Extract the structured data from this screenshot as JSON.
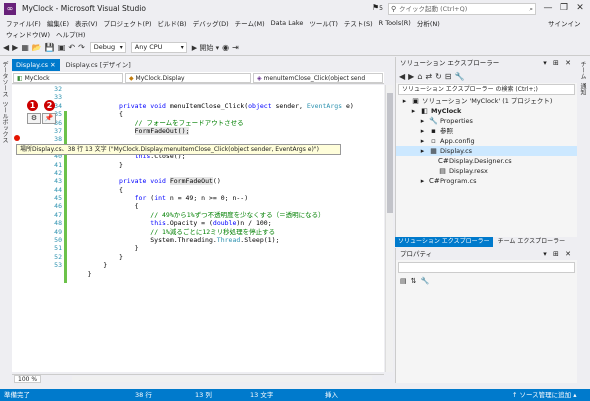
{
  "window": {
    "title": "MyClock - Microsoft Visual Studio",
    "minimize": "—",
    "restore": "❐",
    "close": "✕"
  },
  "notifications": {
    "count": "5"
  },
  "quick_launch": {
    "placeholder": "クイック起動 (Ctrl+Q)"
  },
  "menu": [
    "ファイル(F)",
    "編集(E)",
    "表示(V)",
    "プロジェクト(P)",
    "ビルド(B)",
    "デバッグ(D)",
    "チーム(M)",
    "Data Lake",
    "ツール(T)",
    "テスト(S)",
    "R Tools(R)",
    "分析(N)"
  ],
  "menu2": [
    "ウィンドウ(W)",
    "ヘルプ(H)"
  ],
  "signin": "サインイン",
  "toolbar": {
    "config": "Debug",
    "platform": "Any CPU",
    "start": "▶ 開始 ▾"
  },
  "left_tabs": [
    "データソース",
    "ツールボックス"
  ],
  "right_tabs": [
    "チーム",
    "通知"
  ],
  "doc_tabs": [
    {
      "label": "Display.cs",
      "close": "✕"
    },
    {
      "label": "Display.cs [デザイン]"
    }
  ],
  "nav": {
    "project": "MyClock",
    "class": "MyClock.Display",
    "member": "menuItemClose_Click(object send"
  },
  "line_numbers": [
    "32",
    "33",
    "34",
    "35",
    "36",
    "37",
    "38",
    "39",
    "40",
    "41",
    "42",
    "43",
    "44",
    "45",
    "46",
    "47",
    "48",
    "49",
    "50",
    "51",
    "52",
    "53"
  ],
  "code_lines": [
    {
      "parts": [
        {
          "t": "            ",
          "c": ""
        },
        {
          "t": "private void",
          "c": "kw"
        },
        {
          "t": " menuItemClose_Click(",
          "c": ""
        },
        {
          "t": "object",
          "c": "kw"
        },
        {
          "t": " sender, ",
          "c": ""
        },
        {
          "t": "EventArgs",
          "c": "ty"
        },
        {
          "t": " e)",
          "c": ""
        }
      ]
    },
    {
      "parts": [
        {
          "t": "            {",
          "c": ""
        }
      ]
    },
    {
      "parts": [
        {
          "t": "                ",
          "c": ""
        },
        {
          "t": "// フォームをフェードアウトさせる",
          "c": "cm"
        }
      ]
    },
    {
      "parts": [
        {
          "t": "                ",
          "c": ""
        },
        {
          "t": "FormFadeOut();",
          "c": "hl"
        }
      ]
    }
  ],
  "code_lines_b": [
    {
      "parts": [
        {
          "t": "                this",
          "c": "kw"
        },
        {
          "t": ".Close();",
          "c": ""
        }
      ]
    },
    {
      "parts": [
        {
          "t": "            }",
          "c": ""
        }
      ]
    },
    {
      "parts": [
        {
          "t": "",
          "c": ""
        }
      ]
    },
    {
      "parts": [
        {
          "t": "            ",
          "c": ""
        },
        {
          "t": "private void",
          "c": "kw"
        },
        {
          "t": " ",
          "c": ""
        },
        {
          "t": "FormFadeOut",
          "c": "hl"
        },
        {
          "t": "()",
          "c": ""
        }
      ]
    },
    {
      "parts": [
        {
          "t": "            {",
          "c": ""
        }
      ]
    },
    {
      "parts": [
        {
          "t": "                ",
          "c": ""
        },
        {
          "t": "for",
          "c": "kw"
        },
        {
          "t": " (",
          "c": ""
        },
        {
          "t": "int",
          "c": "kw"
        },
        {
          "t": " n = 49; n >= 0; n--)",
          "c": ""
        }
      ]
    },
    {
      "parts": [
        {
          "t": "                {",
          "c": ""
        }
      ]
    },
    {
      "parts": [
        {
          "t": "                    ",
          "c": ""
        },
        {
          "t": "// 49%から1%ずつ不透明度を少なくする（＝透明になる）",
          "c": "cm"
        }
      ]
    },
    {
      "parts": [
        {
          "t": "                    ",
          "c": ""
        },
        {
          "t": "this",
          "c": "kw"
        },
        {
          "t": ".Opacity = (",
          "c": ""
        },
        {
          "t": "double",
          "c": "kw"
        },
        {
          "t": ")n / 100;",
          "c": ""
        }
      ]
    },
    {
      "parts": [
        {
          "t": "                    ",
          "c": ""
        },
        {
          "t": "// 1%減るごとに12ミリ秒処理を停止する",
          "c": "cm"
        }
      ]
    },
    {
      "parts": [
        {
          "t": "                    System.Threading.",
          "c": ""
        },
        {
          "t": "Thread",
          "c": "ty"
        },
        {
          "t": ".Sleep(1);",
          "c": ""
        }
      ]
    },
    {
      "parts": [
        {
          "t": "                }",
          "c": ""
        }
      ]
    },
    {
      "parts": [
        {
          "t": "            }",
          "c": ""
        }
      ]
    },
    {
      "parts": [
        {
          "t": "        }",
          "c": ""
        }
      ]
    },
    {
      "parts": [
        {
          "t": "    }",
          "c": ""
        }
      ]
    }
  ],
  "badges": {
    "one": "1",
    "two": "2"
  },
  "tooltip": "場所Display.cs、38 行 13 文字 (\"MyClock.Display.menuItemClose_Click(object sender, EventArgs e)\")",
  "zoom": "100 %",
  "solution": {
    "title": "ソリューション エクスプローラー",
    "search": "ソリューション エクスプローラー の検索 (Ctrl+;)",
    "items": [
      {
        "label": "ソリューション 'MyClock' (1 プロジェクト)",
        "indent": 0,
        "icon": "▣"
      },
      {
        "label": "MyClock",
        "indent": 1,
        "icon": "◧",
        "bold": true
      },
      {
        "label": "Properties",
        "indent": 2,
        "icon": "🔧"
      },
      {
        "label": "参照",
        "indent": 2,
        "icon": "▪"
      },
      {
        "label": "App.config",
        "indent": 2,
        "icon": "▫"
      },
      {
        "label": "Display.cs",
        "indent": 2,
        "icon": "▦",
        "sel": true
      },
      {
        "label": "Display.Designer.cs",
        "indent": 3,
        "icon": "C#"
      },
      {
        "label": "Display.resx",
        "indent": 3,
        "icon": "▤"
      },
      {
        "label": "Program.cs",
        "indent": 2,
        "icon": "C#"
      }
    ]
  },
  "bottom_tabs": [
    "ソリューション エクスプローラー",
    "チーム エクスプローラー"
  ],
  "properties": {
    "title": "プロパティ"
  },
  "status": {
    "ready": "準備完了",
    "line": "38 行",
    "col": "13 列",
    "char": "13 文字",
    "mode": "挿入",
    "scm": "↑ ソース管理に追加 ▴"
  }
}
